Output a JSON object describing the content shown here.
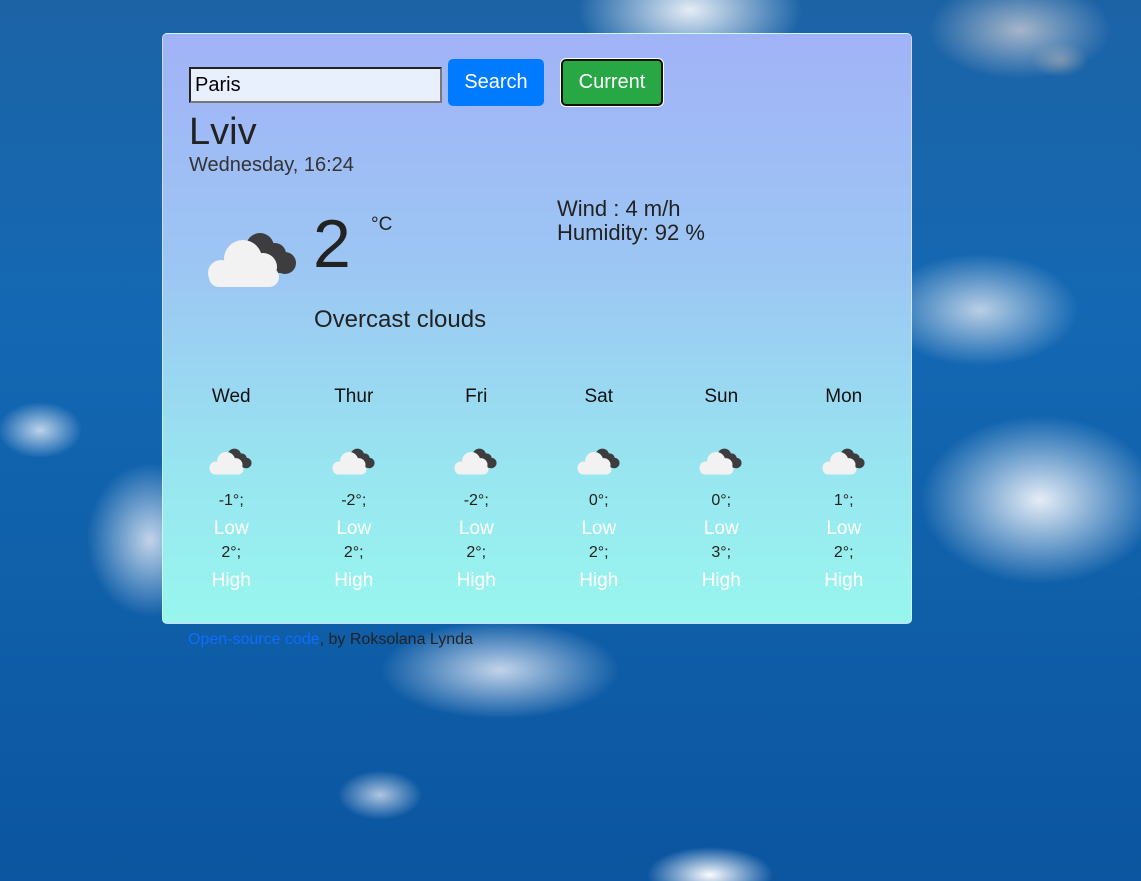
{
  "search": {
    "value": "Paris",
    "placeholder": "",
    "search_label": "Search",
    "current_label": "Current"
  },
  "current": {
    "city": "Lviv",
    "datetime": "Wednesday, 16:24",
    "temperature": "2",
    "unit": "°C",
    "description": "Overcast clouds",
    "icon": "overcast-clouds-icon",
    "wind": "Wind : 4 m/h",
    "humidity": "Humidity: 92 %"
  },
  "forecast": [
    {
      "day": "Wed",
      "low": "-1°;",
      "low_label": "Low",
      "high": "2°;",
      "high_label": "High",
      "icon": "overcast-clouds-icon"
    },
    {
      "day": "Thur",
      "low": "-2°;",
      "low_label": "Low",
      "high": "2°;",
      "high_label": "High",
      "icon": "overcast-clouds-icon"
    },
    {
      "day": "Fri",
      "low": "-2°;",
      "low_label": "Low",
      "high": "2°;",
      "high_label": "High",
      "icon": "overcast-clouds-icon"
    },
    {
      "day": "Sat",
      "low": "0°;",
      "low_label": "Low",
      "high": "2°;",
      "high_label": "High",
      "icon": "overcast-clouds-icon"
    },
    {
      "day": "Sun",
      "low": "0°;",
      "low_label": "Low",
      "high": "3°;",
      "high_label": "High",
      "icon": "overcast-clouds-icon"
    },
    {
      "day": "Mon",
      "low": "1°;",
      "low_label": "Low",
      "high": "2°;",
      "high_label": "High",
      "icon": "overcast-clouds-icon"
    }
  ],
  "footer": {
    "link_text": "Open-source code",
    "suffix": ", by Roksolana Lynda"
  },
  "colors": {
    "search_button": "#007bff",
    "current_button": "#28a745",
    "link": "#0d6efd"
  }
}
